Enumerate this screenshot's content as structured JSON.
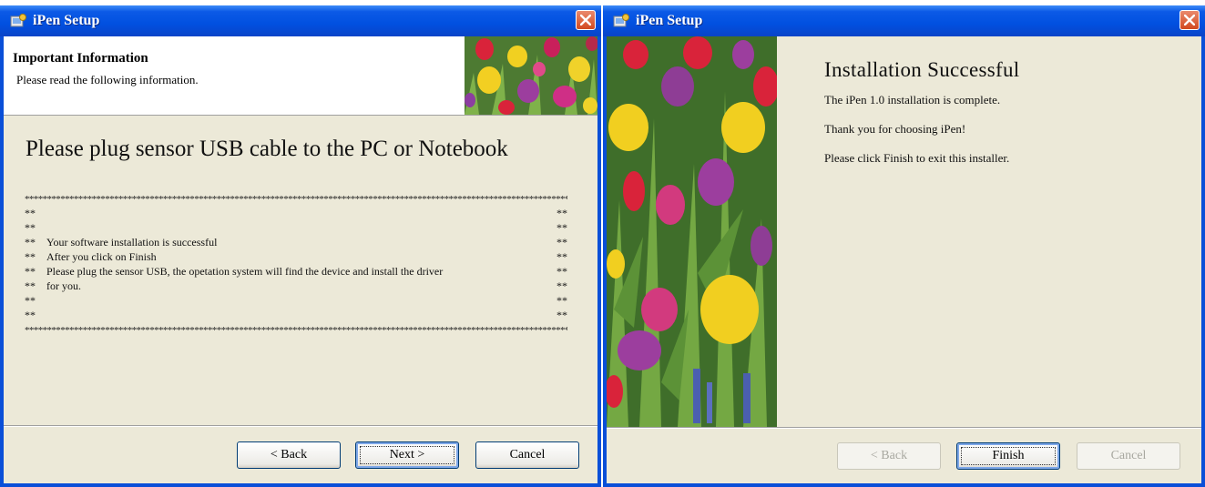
{
  "left_window": {
    "title": "iPen Setup",
    "header_title": "Important Information",
    "header_subtitle": "Please read the following information.",
    "message": "Please plug sensor USB cable to the PC or Notebook",
    "notice_border": "****************************************************************************************************************************************************",
    "notice_edge": "**",
    "notice_lines": [
      "",
      "",
      "Your  software installation is successful",
      "After you click on Finish",
      "Please  plug the sensor USB, the opetation system will find the device and install the driver",
      "for you.",
      "",
      ""
    ],
    "buttons": {
      "back_label": "< Back",
      "next_label": "Next >",
      "cancel_label": "Cancel"
    }
  },
  "right_window": {
    "title": "iPen Setup",
    "heading": "Installation Successful",
    "lines": [
      "The iPen 1.0 installation is complete.",
      "Thank you for choosing iPen!",
      "Please click Finish to exit this installer."
    ],
    "buttons": {
      "back_label": "< Back",
      "finish_label": "Finish",
      "cancel_label": "Cancel"
    }
  },
  "icons": {
    "app_icon": "setup-icon",
    "close_icon": "close-icon"
  },
  "colors": {
    "title_bar": "#0150e0",
    "dialog_bg": "#ece9d8",
    "close_button": "#d2491f"
  }
}
